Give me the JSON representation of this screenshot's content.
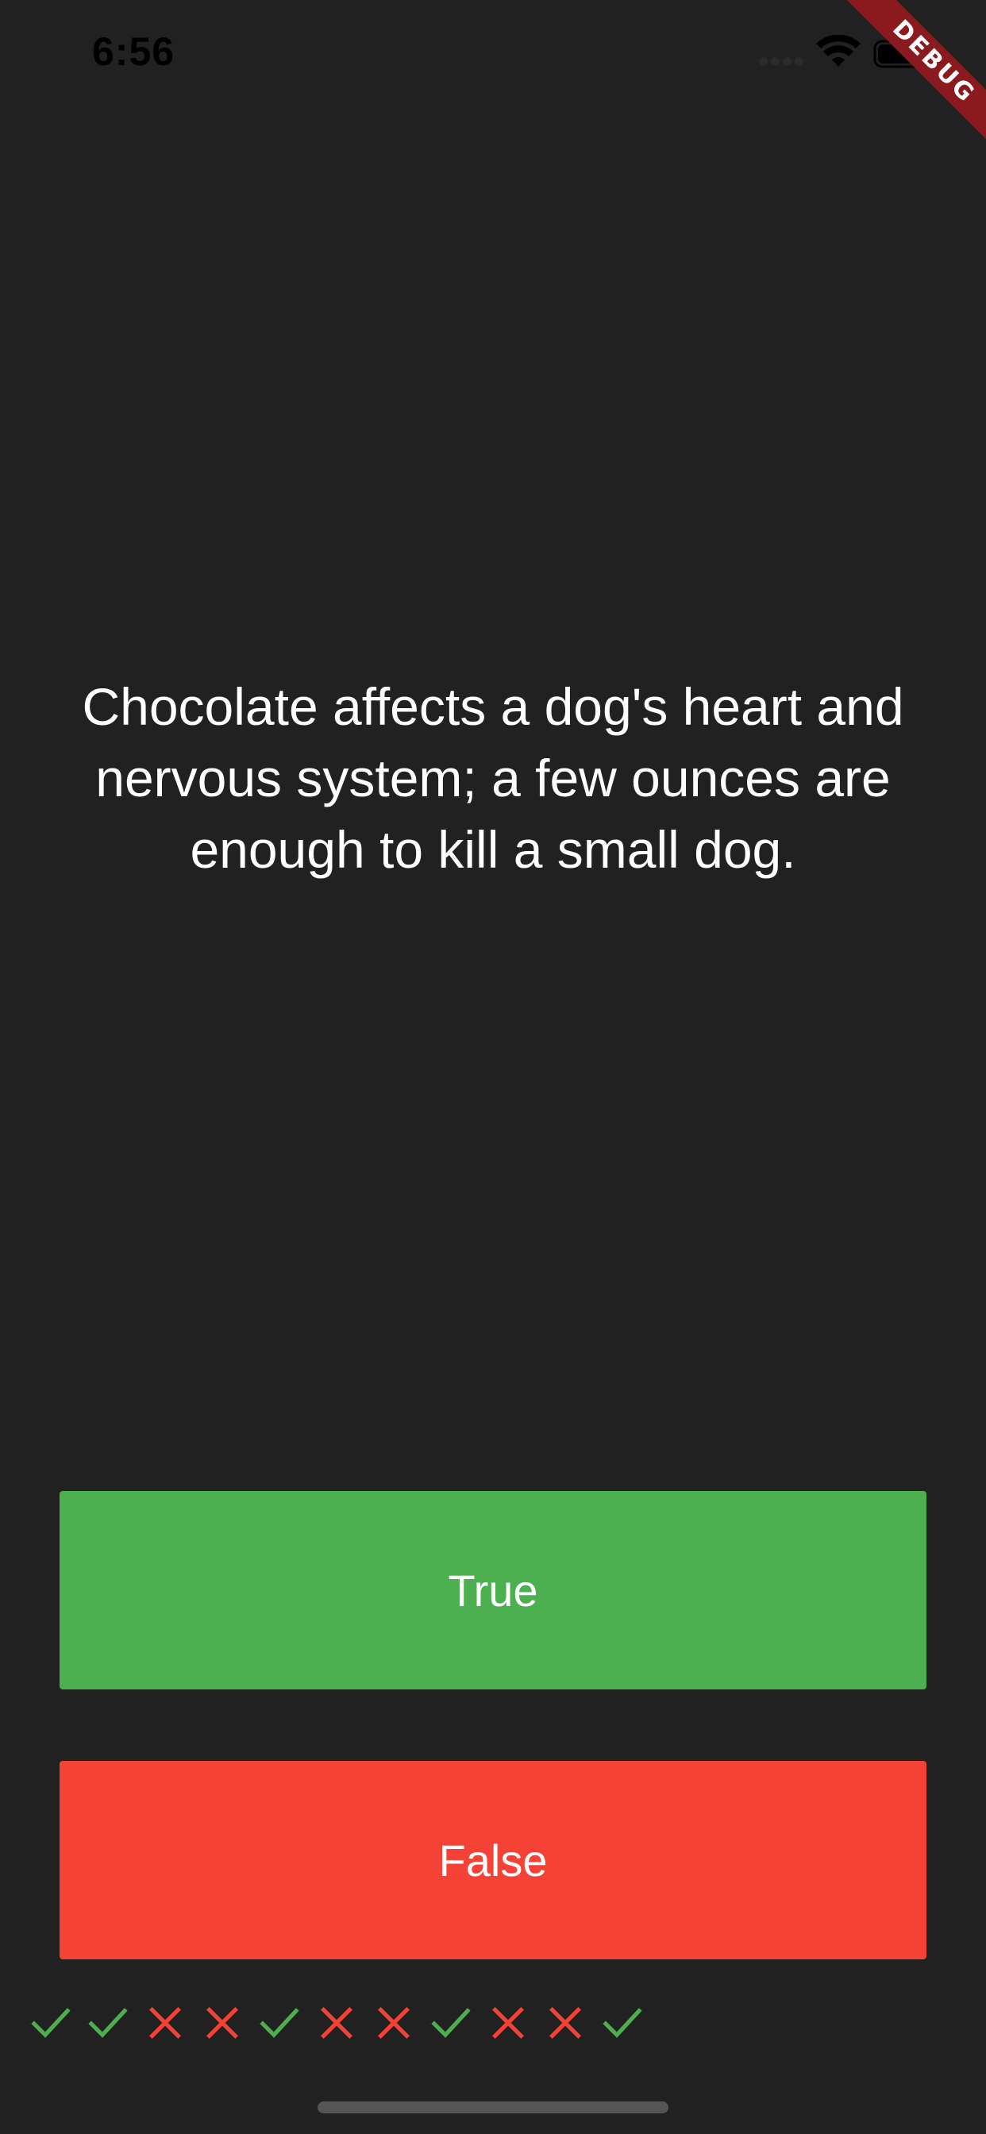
{
  "status_bar": {
    "time": "6:56"
  },
  "debug_banner": {
    "label": "DEBUG"
  },
  "question": {
    "text": "Chocolate affects a dog's heart and nervous system; a few ounces are enough to kill a small dog."
  },
  "buttons": {
    "true_label": "True",
    "false_label": "False"
  },
  "score_keeper": {
    "marks": [
      "check",
      "check",
      "close",
      "close",
      "check",
      "close",
      "close",
      "check",
      "close",
      "close",
      "check"
    ]
  },
  "colors": {
    "background": "#212121",
    "true_button": "#4caf50",
    "false_button": "#f44336",
    "check": "#4caf50",
    "close": "#f44336",
    "debug_ribbon": "#8a1a1e"
  }
}
